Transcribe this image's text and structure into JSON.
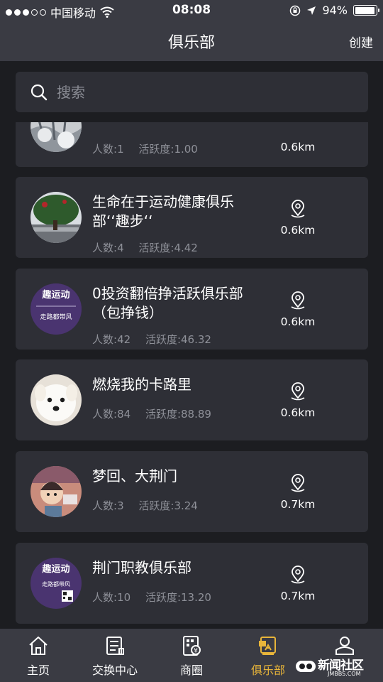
{
  "status_bar": {
    "carrier": "中国移动",
    "time": "08:08",
    "battery": "94%",
    "battery_level": 0.94,
    "signal_bars_filled": 3,
    "signal_bars_total": 5
  },
  "nav": {
    "title": "俱乐部",
    "action_label": "创建"
  },
  "search": {
    "placeholder": "搜索"
  },
  "labels": {
    "members_prefix": "人数:",
    "activity_prefix": "活跃度:"
  },
  "clubs": [
    {
      "name": "",
      "members": "1",
      "activity": "1.00",
      "distance": "0.6km",
      "avatar_icon": "snowy-trees-photo"
    },
    {
      "name": "生命在于运动健康俱乐部‘‘趣步‘‘",
      "members": "4",
      "activity": "4.42",
      "distance": "0.6km",
      "avatar_icon": "tree-landscape-photo"
    },
    {
      "name": "0投资翻倍挣活跃俱乐部（包挣钱）",
      "members": "42",
      "activity": "46.32",
      "distance": "0.6km",
      "avatar_icon": "qubu-poster-image"
    },
    {
      "name": "燃烧我的卡路里",
      "members": "84",
      "activity": "88.89",
      "distance": "0.6km",
      "avatar_icon": "white-dog-photo"
    },
    {
      "name": "梦回、大荆门",
      "members": "3",
      "activity": "3.24",
      "distance": "0.7km",
      "avatar_icon": "cartoon-character-image"
    },
    {
      "name": "荆门职教俱乐部",
      "members": "10",
      "activity": "13.20",
      "distance": "0.7km",
      "avatar_icon": "qubu-poster-qr-image"
    }
  ],
  "avatar_text": {
    "qubu_title": "趣运动",
    "qubu_slogan": "走路都带风"
  },
  "tabs": [
    {
      "label": "主页",
      "icon": "home-icon",
      "active": false
    },
    {
      "label": "交换中心",
      "icon": "exchange-center-icon",
      "active": false
    },
    {
      "label": "商圈",
      "icon": "business-circle-icon",
      "active": false
    },
    {
      "label": "俱乐部",
      "icon": "club-icon",
      "active": true
    },
    {
      "label": "",
      "icon": "profile-icon",
      "active": false
    }
  ],
  "watermark": {
    "text": "新闻社区",
    "sub": "JMBBS.COM"
  },
  "colors": {
    "background": "#1c1d21",
    "bar": "#3a3b43",
    "card": "#2e2f36",
    "accent": "#e8b53a",
    "muted_text": "#8e9098"
  }
}
